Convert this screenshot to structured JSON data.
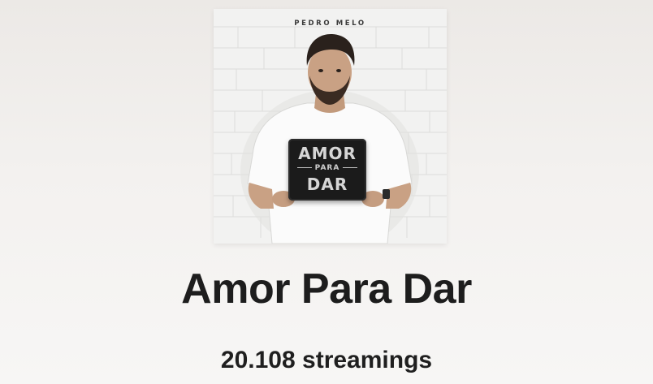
{
  "album": {
    "artist": "PEDRO MELO",
    "cover_sign_lines": [
      "AMOR",
      "PARA",
      "DAR"
    ],
    "title": "Amor Para Dar",
    "streams": "20.108 streamings"
  }
}
